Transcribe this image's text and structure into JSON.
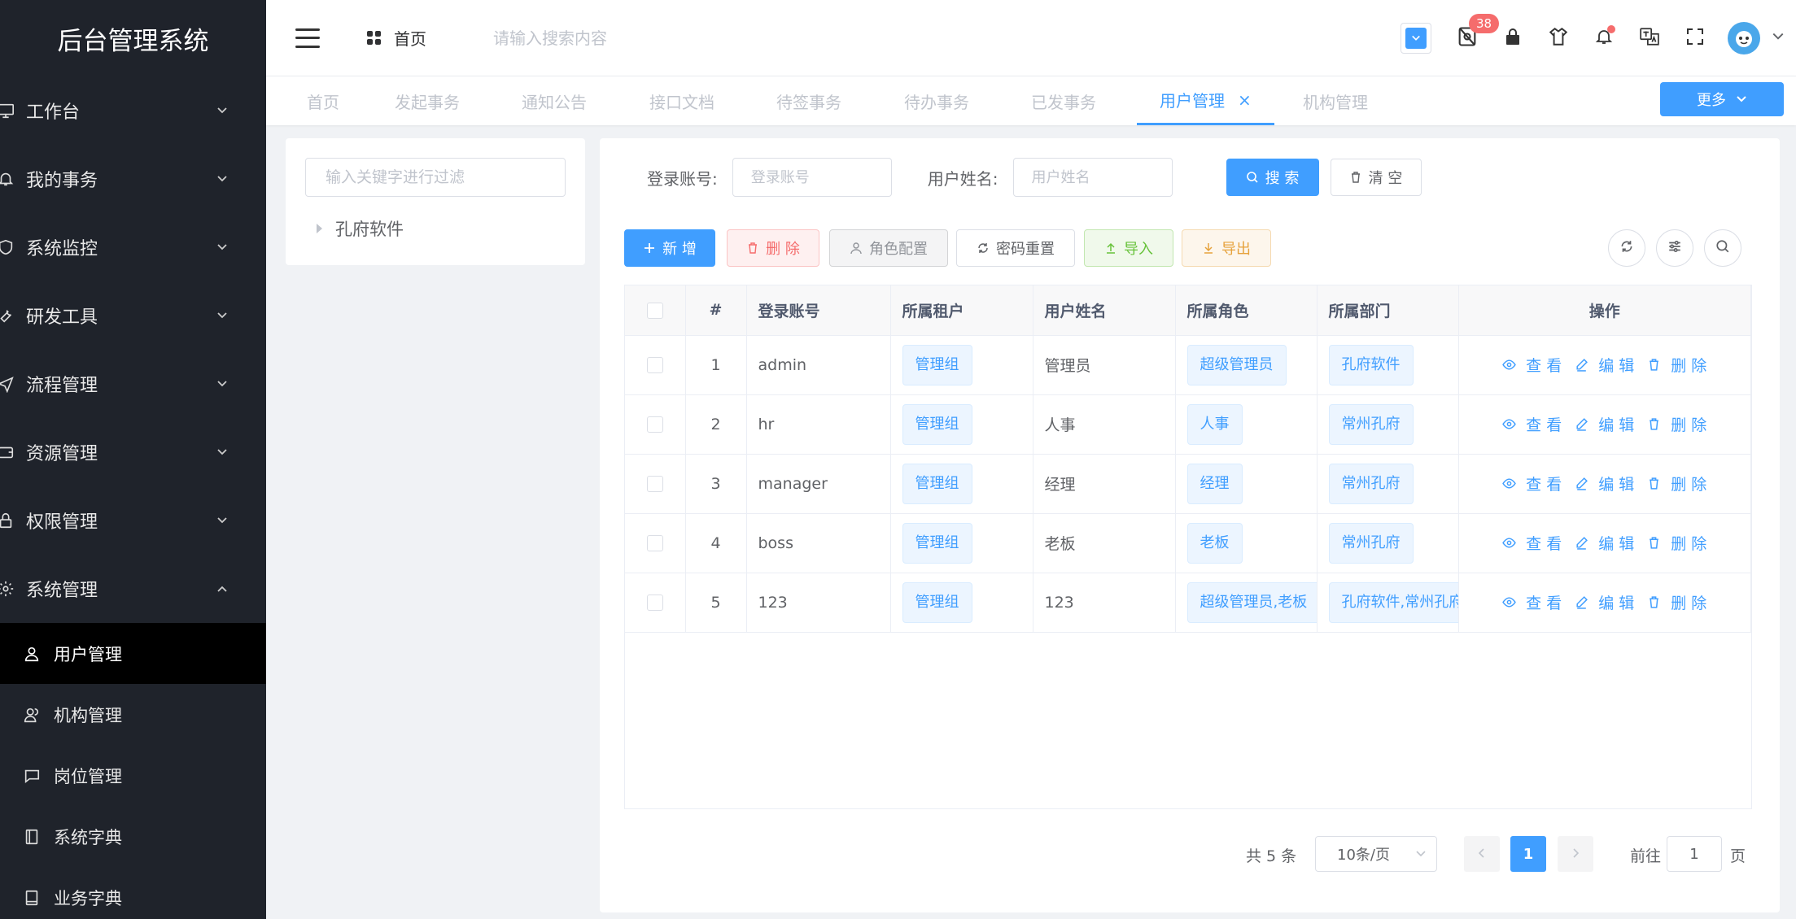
{
  "app": {
    "title": "后台管理系统"
  },
  "sidebar": {
    "items": [
      {
        "label": "工作台",
        "icon": "monitor-icon",
        "expanded": false
      },
      {
        "label": "我的事务",
        "icon": "bell-icon",
        "expanded": false
      },
      {
        "label": "系统监控",
        "icon": "shield-icon",
        "expanded": false
      },
      {
        "label": "研发工具",
        "icon": "wrench-icon",
        "expanded": false
      },
      {
        "label": "流程管理",
        "icon": "send-icon",
        "expanded": false
      },
      {
        "label": "资源管理",
        "icon": "wallet-icon",
        "expanded": false
      },
      {
        "label": "权限管理",
        "icon": "lock-icon",
        "expanded": false
      },
      {
        "label": "系统管理",
        "icon": "gear-icon",
        "expanded": true
      }
    ],
    "submenu": [
      {
        "label": "用户管理",
        "icon": "user-icon",
        "active": true
      },
      {
        "label": "机构管理",
        "icon": "users-icon",
        "active": false
      },
      {
        "label": "岗位管理",
        "icon": "chat-icon",
        "active": false
      },
      {
        "label": "系统字典",
        "icon": "notebook-icon",
        "active": false
      },
      {
        "label": "业务字典",
        "icon": "book-icon",
        "active": false
      }
    ]
  },
  "header": {
    "home_label": "首页",
    "search_placeholder": "请输入搜索内容",
    "notification_count": "38"
  },
  "tabs": {
    "items": [
      {
        "label": "首页"
      },
      {
        "label": "发起事务"
      },
      {
        "label": "通知公告"
      },
      {
        "label": "接口文档"
      },
      {
        "label": "待签事务"
      },
      {
        "label": "待办事务"
      },
      {
        "label": "已发事务"
      },
      {
        "label": "用户管理",
        "active": true,
        "closable": true
      },
      {
        "label": "机构管理"
      }
    ],
    "more_label": "更多"
  },
  "tree": {
    "filter_placeholder": "输入关键字进行过滤",
    "root_label": "孔府软件"
  },
  "filters": {
    "account_label": "登录账号:",
    "account_placeholder": "登录账号",
    "name_label": "用户姓名:",
    "name_placeholder": "用户姓名",
    "search_label": "搜 索",
    "clear_label": "清 空"
  },
  "toolbar": {
    "add_label": "新 增",
    "delete_label": "删 除",
    "role_label": "角色配置",
    "reset_label": "密码重置",
    "import_label": "导入",
    "export_label": "导出"
  },
  "table": {
    "headers": [
      "#",
      "登录账号",
      "所属租户",
      "用户姓名",
      "所属角色",
      "所属部门",
      "操作"
    ],
    "rows": [
      {
        "index": "1",
        "account": "admin",
        "tenant": "管理组",
        "name": "管理员",
        "role": "超级管理员",
        "dept": "孔府软件"
      },
      {
        "index": "2",
        "account": "hr",
        "tenant": "管理组",
        "name": "人事",
        "role": "人事",
        "dept": "常州孔府"
      },
      {
        "index": "3",
        "account": "manager",
        "tenant": "管理组",
        "name": "经理",
        "role": "经理",
        "dept": "常州孔府"
      },
      {
        "index": "4",
        "account": "boss",
        "tenant": "管理组",
        "name": "老板",
        "role": "老板",
        "dept": "常州孔府"
      },
      {
        "index": "5",
        "account": "123",
        "tenant": "管理组",
        "name": "123",
        "role": "超级管理员,老板",
        "dept": "孔府软件,常州孔府"
      }
    ],
    "actions": {
      "view": "查 看",
      "edit": "编 辑",
      "delete": "删 除"
    }
  },
  "pagination": {
    "total_label": "共 5 条",
    "page_size_label": "10条/页",
    "current_page": "1",
    "goto_label": "前往",
    "goto_value": "1",
    "page_suffix": "页"
  },
  "colors": {
    "primary": "#409eff",
    "sidebar_bg": "#1f232b",
    "danger": "#f56c6c",
    "success": "#67c23a",
    "warning": "#e6a23c"
  }
}
